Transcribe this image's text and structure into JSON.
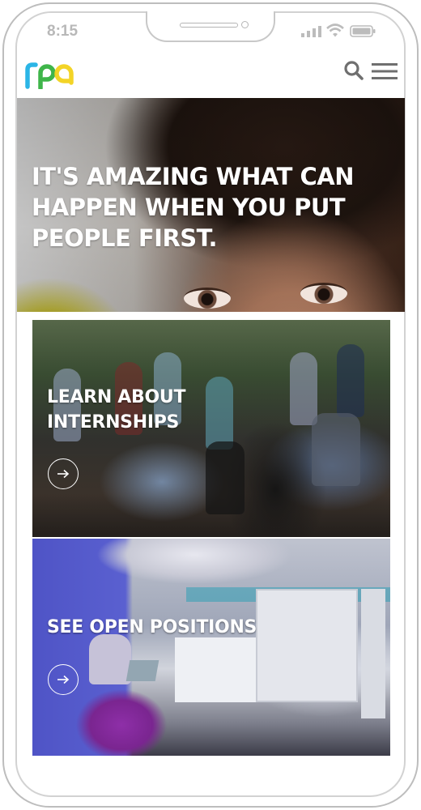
{
  "status_bar": {
    "time": "8:15"
  },
  "header": {
    "logo_text": "rpa",
    "logo_colors": [
      "#2bb5e6",
      "#3fb54a",
      "#f2d21b"
    ],
    "icons": [
      "search-icon",
      "hamburger-menu-icon"
    ]
  },
  "hero": {
    "title": "IT'S AMAZING WHAT CAN HAPPEN WHEN YOU PUT PEOPLE FIRST."
  },
  "cards": [
    {
      "title": "LEARN ABOUT INTERNSHIPS",
      "icon": "arrow-right-icon"
    },
    {
      "title": "SEE OPEN POSITIONS",
      "icon": "arrow-right-icon"
    }
  ],
  "colors": {
    "frame": "#bdbdbd",
    "status_text": "#b8b8b8",
    "icon_gray": "#6f6f6f",
    "text_on_image": "#ffffff"
  }
}
